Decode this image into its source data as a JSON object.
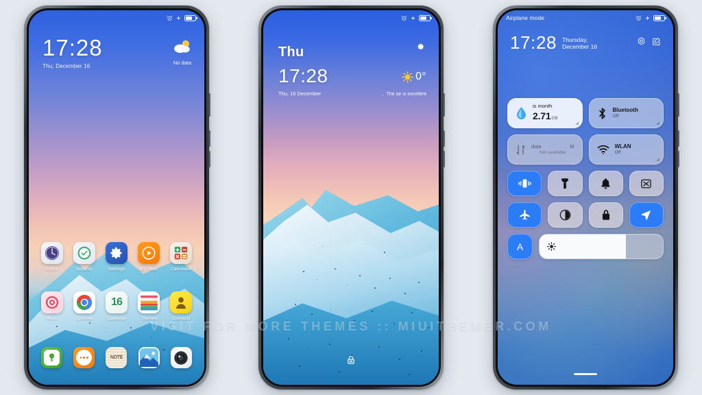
{
  "watermark": "VISIT FOR MORE THEMES :: MIUITHEMER.COM",
  "colors": {
    "accent_blue": "#2b7cf6",
    "page_bg": "#e4e9ef",
    "frame": "#2f3338",
    "status_text": "#ffffff"
  },
  "phone1": {
    "name": "Home screen",
    "statusbar": {
      "left": "",
      "alarm_icon": "alarm-icon",
      "silent_icon": "silent-icon",
      "battery_icon": "battery-icon"
    },
    "clock": {
      "time": "17:28",
      "date": "Thu, December 16"
    },
    "weather": {
      "icon": "partly-cloudy-icon",
      "label": "No data"
    },
    "apps_row1": [
      {
        "label": "Clock",
        "icon": "clock-app-icon"
      },
      {
        "label": "Security",
        "icon": "security-app-icon"
      },
      {
        "label": "Settings",
        "icon": "settings-app-icon"
      },
      {
        "label": "Mi Video",
        "icon": "mi-video-app-icon"
      },
      {
        "label": "Calculator",
        "icon": "calculator-app-icon"
      }
    ],
    "apps_row2": [
      {
        "label": "Music",
        "icon": "music-app-icon"
      },
      {
        "label": "Chrome",
        "icon": "chrome-app-icon"
      },
      {
        "label": "Calendar",
        "icon": "calendar-app-icon",
        "day": "16"
      },
      {
        "label": "Themes",
        "icon": "themes-app-icon"
      },
      {
        "label": "Contacts",
        "icon": "contacts-app-icon"
      }
    ],
    "dock": [
      {
        "label": "Phone",
        "icon": "phone-app-icon"
      },
      {
        "label": "Messages",
        "icon": "messages-app-icon"
      },
      {
        "label": "Notes",
        "icon": "notes-app-icon"
      },
      {
        "label": "Gallery",
        "icon": "gallery-app-icon"
      },
      {
        "label": "Camera",
        "icon": "camera-app-icon"
      }
    ]
  },
  "phone2": {
    "name": "Lock screen",
    "statusbar": {
      "alarm_icon": "alarm-icon",
      "silent_icon": "silent-icon",
      "battery_icon": "battery-icon"
    },
    "day": "Thu",
    "time": "17:28",
    "date": "Thu, 16 December",
    "settings_icon": "gear-icon",
    "weather": {
      "icon": "sunny-icon",
      "temp": "0°",
      "air_quality": "The air is excellent",
      "separator": ","
    },
    "lock_icon": "lock-icon"
  },
  "phone3": {
    "name": "Control center",
    "statusbar": {
      "left": "Airplane mode",
      "alarm_icon": "alarm-icon",
      "silent_icon": "silent-icon",
      "battery_icon": "battery-icon"
    },
    "time": "17:28",
    "date": "Thursday, December 16",
    "header_actions": [
      {
        "name": "settings-hex-icon"
      },
      {
        "name": "edit-icon"
      }
    ],
    "big_tiles": [
      {
        "name": "data-usage-tile",
        "title": "is month",
        "value": "2.71",
        "unit": "GB",
        "icon": "water-drop-icon",
        "style": "light"
      },
      {
        "name": "bluetooth-tile",
        "title": "Bluetooth",
        "subtitle": "Off",
        "icon": "bluetooth-icon",
        "style": "glass"
      },
      {
        "name": "mobile-data-tile",
        "title_left": "data",
        "title_right": "M",
        "subtitle": "Not available",
        "icon": "data-arrows-icon",
        "style": "dim"
      },
      {
        "name": "wlan-tile",
        "title": "WLAN",
        "subtitle": "Off",
        "icon": "wifi-icon",
        "style": "glass"
      }
    ],
    "toggles": [
      {
        "name": "vibrate-toggle",
        "icon": "vibrate-icon",
        "state": "on"
      },
      {
        "name": "flashlight-toggle",
        "icon": "flashlight-icon",
        "state": "off"
      },
      {
        "name": "ringer-toggle",
        "icon": "bell-icon",
        "state": "off"
      },
      {
        "name": "screenshot-toggle",
        "icon": "screenshot-icon",
        "state": "off"
      },
      {
        "name": "airplane-toggle",
        "icon": "airplane-icon",
        "state": "on"
      },
      {
        "name": "dark-mode-toggle",
        "icon": "contrast-icon",
        "state": "off"
      },
      {
        "name": "lock-toggle",
        "icon": "padlock-icon",
        "state": "off"
      },
      {
        "name": "location-toggle",
        "icon": "location-arrow-icon",
        "state": "on"
      }
    ],
    "brightness": {
      "auto_label": "A",
      "icon": "sun-icon",
      "level_percent": 70
    }
  }
}
